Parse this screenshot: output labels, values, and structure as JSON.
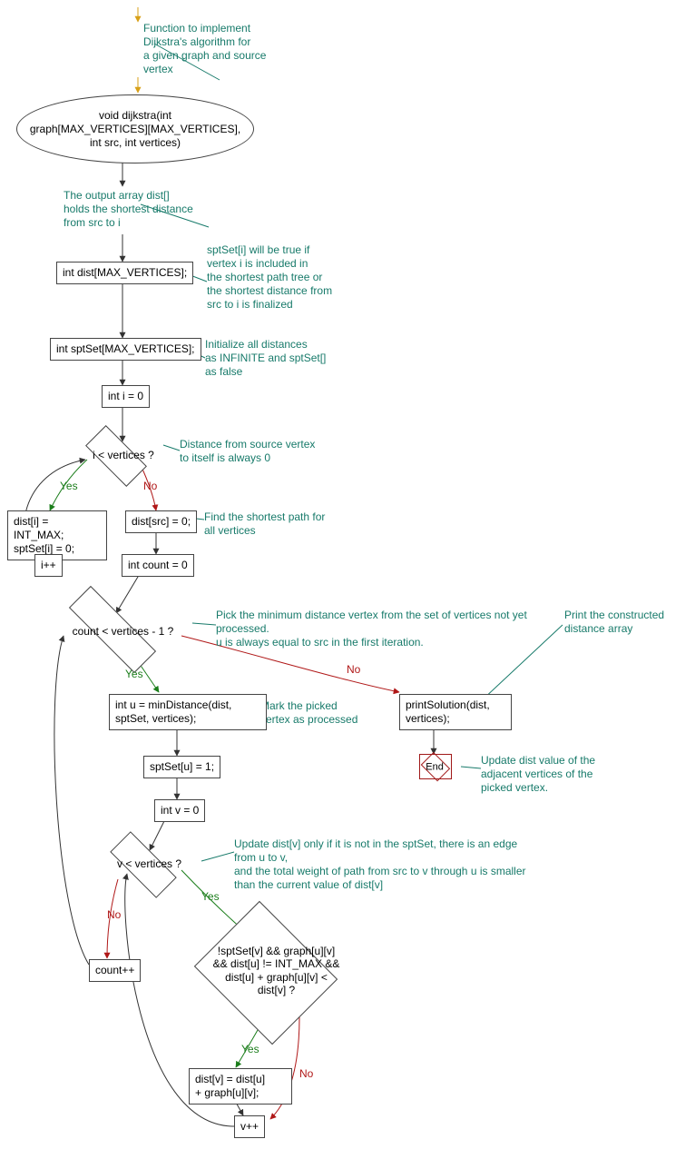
{
  "chart_data": {
    "type": "flowchart",
    "comments": {
      "c_top": "Function to implement\nDijkstra's algorithm for\na given graph and source\nvertex",
      "c_dist": "The output array dist[]\nholds the shortest distance\nfrom src to i",
      "c_sptset": "sptSet[i] will be true if\nvertex i is included in\nthe shortest path tree or\nthe shortest distance from\nsrc to i is finalized",
      "c_init": "Initialize all distances\nas INFINITE and sptSet[]\nas false",
      "c_src0": "Distance from source vertex\nto itself is always 0",
      "c_findall": "Find the shortest path for\nall vertices",
      "c_pick": "Pick the minimum distance vertex from the set of vertices not yet\nprocessed.\nu is always equal to src in the first iteration.",
      "c_mark": "Mark the picked\nvertex as processed",
      "c_updatev": "Update dist[v] only if it is not in the sptSet, there is an edge\nfrom u to v,\nand the total weight of path from src to v through u is smaller\nthan the current value of dist[v]",
      "c_print": "Print the constructed\ndistance array",
      "c_updateadj": "Update dist value of the\nadjacent vertices of the\npicked vertex."
    },
    "nodes": {
      "n_sig": "void dijkstra(int\ngraph[MAX_VERTICES][MAX_VERTICES],\nint src, int vertices)",
      "n_distdecl": "int dist[MAX_VERTICES];",
      "n_sptdecl": "int sptSet[MAX_VERTICES];",
      "n_i0": "int i = 0",
      "n_iloop": "i < vertices ?",
      "n_initbody": "dist[i] = INT_MAX;\nsptSet[i] = 0;",
      "n_ipp": "i++",
      "n_src0": "dist[src] = 0;",
      "n_count0": "int count = 0",
      "n_countloop": "count < vertices - 1 ?",
      "n_mindist": "int u = minDistance(dist,\nsptSet, vertices);",
      "n_marku": "sptSet[u] = 1;",
      "n_v0": "int v = 0",
      "n_vloop": "v < vertices ?",
      "n_cond": "!sptSet[v] && graph[u][v]\n&& dist[u] != INT_MAX &&\ndist[u] + graph[u][v] <\ndist[v] ?",
      "n_update": "dist[v] = dist[u]\n+ graph[u][v];",
      "n_vpp": "v++",
      "n_countpp": "count++",
      "n_print": "printSolution(dist,\nvertices);",
      "n_end": "End"
    },
    "edges": {
      "yes": "Yes",
      "no": "No"
    }
  }
}
